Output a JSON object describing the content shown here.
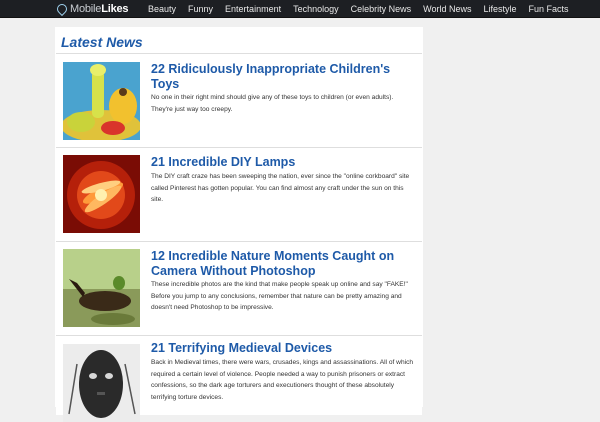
{
  "site": {
    "logo_prefix": "Mobile",
    "logo_suffix": "Likes"
  },
  "nav": {
    "items": [
      "Beauty",
      "Funny",
      "Entertainment",
      "Technology",
      "Celebrity News",
      "World News",
      "Lifestyle",
      "Fun Facts"
    ]
  },
  "main": {
    "section_title": "Latest News",
    "articles": [
      {
        "title": "22 Ridiculously Inappropriate Children's Toys",
        "description": "No one in their right mind should give any of these toys to children (or even adults). They're just way too creepy."
      },
      {
        "title": "21 Incredible DIY Lamps",
        "description": "The DIY craft craze has been sweeping the nation, ever since the \"online corkboard\" site called Pinterest has gotten popular. You can find almost any craft under the sun on this site."
      },
      {
        "title": "12 Incredible Nature Moments Caught on Camera Without Photoshop",
        "description": "These incredible photos are the kind that make people speak up online and say \"FAKE!\" Before you jump to any conclusions, remember that nature can be pretty amazing and doesn't need Photoshop to be impressive."
      },
      {
        "title": "21 Terrifying Medieval Devices",
        "description": "Back in Medieval times, there were wars, crusades, kings and assassinations. All of which required a certain level of violence. People needed a way to punish prisoners or extract confessions, so the dark age torturers and executioners thought of these absolutely terrifying torture devices."
      }
    ]
  }
}
